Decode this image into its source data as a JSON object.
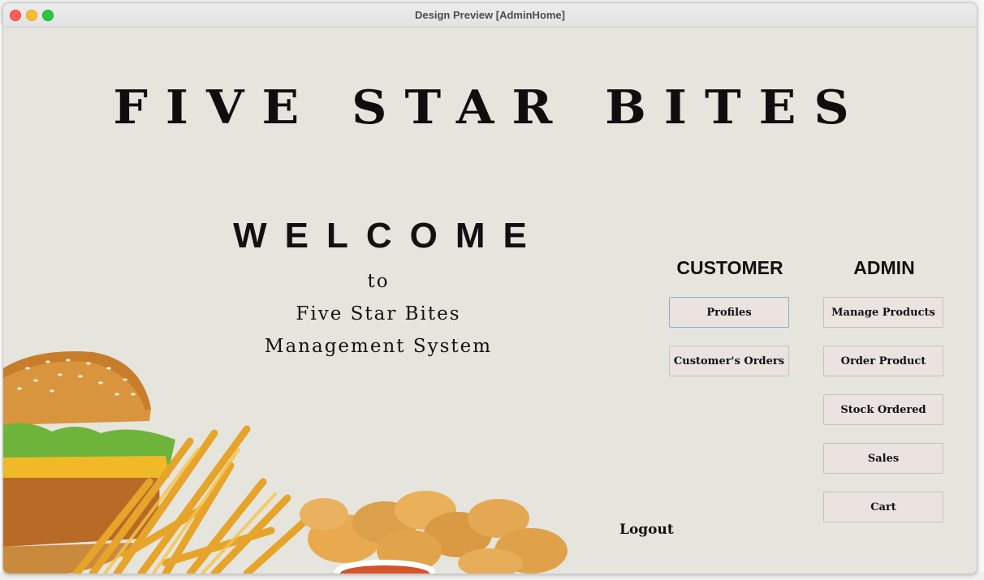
{
  "window": {
    "title": "Design Preview [AdminHome]"
  },
  "brand": {
    "title": "FIVE STAR BITES"
  },
  "welcome": {
    "heading": "WELCOME",
    "line1": "to",
    "line2": "Five Star Bites",
    "line3": "Management System"
  },
  "customer": {
    "heading": "CUSTOMER",
    "buttons": [
      {
        "label": "Profiles"
      },
      {
        "label": "Customer's Orders"
      }
    ]
  },
  "admin": {
    "heading": "ADMIN",
    "buttons": [
      {
        "label": "Manage Products"
      },
      {
        "label": "Order Product"
      },
      {
        "label": "Stock Ordered"
      },
      {
        "label": "Sales"
      },
      {
        "label": "Cart"
      }
    ]
  },
  "logout": {
    "label": "Logout"
  },
  "colors": {
    "background": "#e6e5dd",
    "button": "#ebe3df",
    "focus_border": "#8eaad1",
    "text": "#111111"
  },
  "illustration": {
    "icon": "fast-food-image"
  }
}
